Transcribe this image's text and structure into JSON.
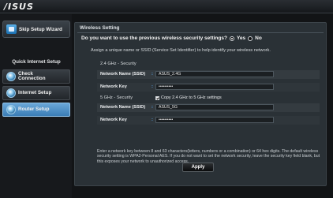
{
  "brand": {
    "logo": "/ISUS"
  },
  "sidebar": {
    "skip_button": "Skip Setup Wizard",
    "section_header": "Quick Internet Setup",
    "items": [
      {
        "label": "Check Connection",
        "line1": "Check",
        "line2": "Connection"
      },
      {
        "label": "Internet Setup"
      },
      {
        "label": "Router Setup"
      }
    ]
  },
  "main": {
    "title": "Wireless Setting",
    "question": "Do you want to use the previous wireless security settings?",
    "yes_label": "Yes",
    "no_label": "No",
    "assign_text": "Assign a unique name or SSID (Service Set Identifier) to help identify your wireless network.",
    "band24": {
      "section_label": "2.4 GHz - Security",
      "ssid_label": "Network Name (SSID)",
      "ssid_value": "ASUS_2.4G",
      "key_label": "Network Key",
      "key_value": "••••••••••"
    },
    "band5": {
      "section_label": "5 GHz - Security",
      "copy_label": "Copy 2.4 GHz to 5 GHz settings",
      "ssid_label": "Network Name (SSID)",
      "ssid_value": "ASUS_5G",
      "key_label": "Network Key",
      "key_value": "••••••••••"
    },
    "separator": ":",
    "note": "Enter a network key between 8 and 63 characters(letters, numbers or a combination) or 64 hex digits. The default wireless security setting is WPA2-Personal AES. If you do not want to set the network security, leave the security key field blank, but this exposes your network to unauthorized access.",
    "apply_label": "Apply"
  },
  "colors": {
    "accent": "#5fb3ff",
    "active_nav": "#4a8ec6",
    "panel_bg": "#2a3136"
  },
  "icons": [
    "wizard-icon",
    "globe-icon",
    "globe-icon",
    "globe-icon"
  ]
}
